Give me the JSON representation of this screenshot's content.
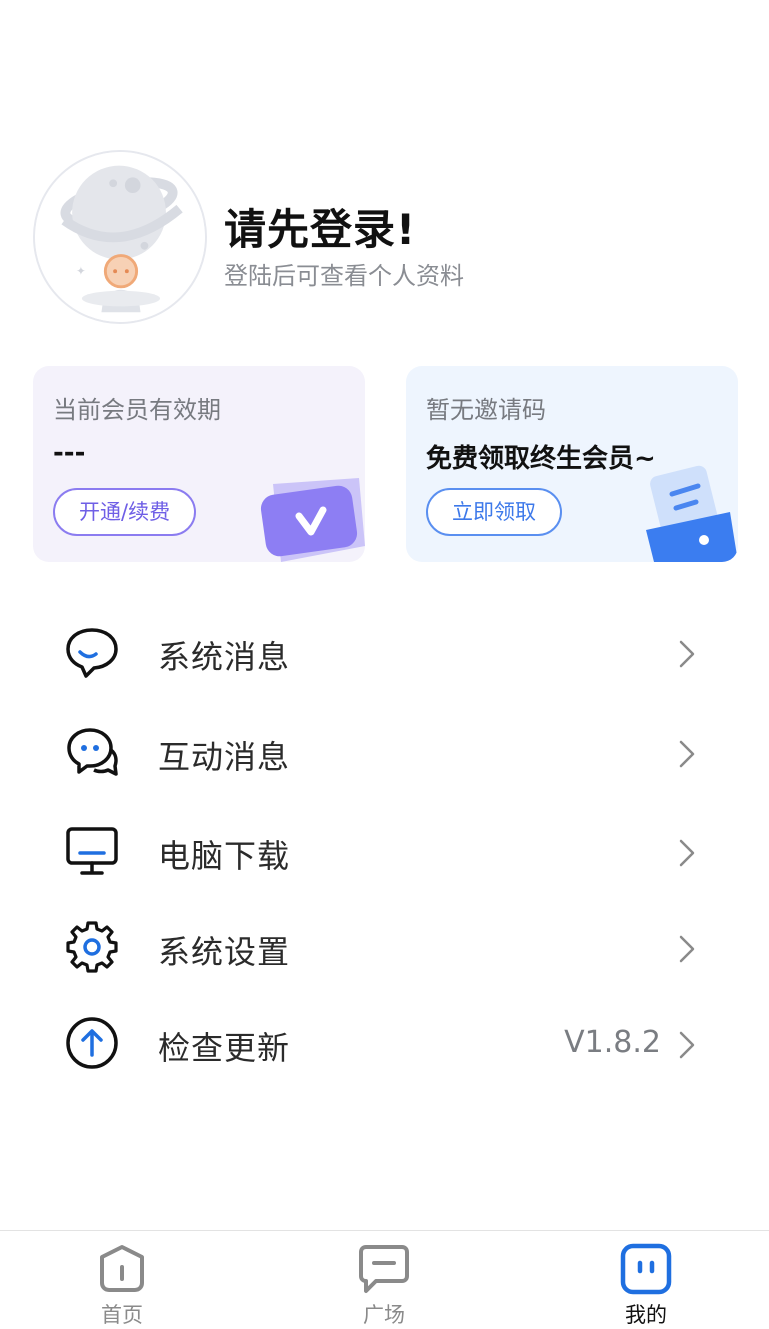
{
  "profile": {
    "title": "请先登录!",
    "subtitle": "登陆后可查看个人资料"
  },
  "cards": {
    "member": {
      "label": "当前会员有效期",
      "value": "---",
      "button": "开通/续费"
    },
    "invite": {
      "label": "暂无邀请码",
      "value": "免费领取终生会员~",
      "button": "立即领取"
    }
  },
  "menu": [
    {
      "label": "系统消息",
      "icon": "chat-bubble-icon",
      "value": ""
    },
    {
      "label": "互动消息",
      "icon": "double-chat-icon",
      "value": ""
    },
    {
      "label": "电脑下载",
      "icon": "monitor-icon",
      "value": ""
    },
    {
      "label": "系统设置",
      "icon": "gear-icon",
      "value": ""
    },
    {
      "label": "检查更新",
      "icon": "arrow-up-circle-icon",
      "value": "V1.8.2"
    }
  ],
  "tabs": [
    {
      "label": "首页",
      "icon": "home-icon",
      "active": false
    },
    {
      "label": "广场",
      "icon": "square-message-icon",
      "active": false
    },
    {
      "label": "我的",
      "icon": "face-icon",
      "active": true
    }
  ],
  "colors": {
    "accent": "#1f6fe0",
    "purple": "#6f5fe6",
    "member_card_bg": "#f4f2fb",
    "invite_card_bg": "#eef5fe"
  }
}
